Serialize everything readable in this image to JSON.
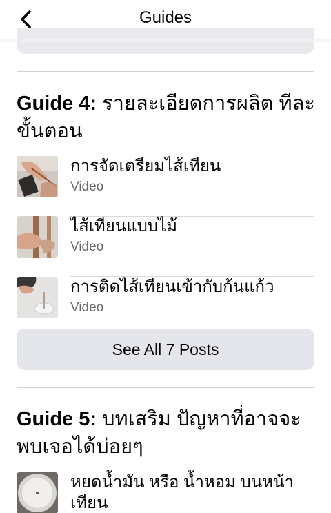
{
  "header": {
    "title": "Guides",
    "back_icon": "chevron-left-icon"
  },
  "guides": [
    {
      "number_label": "Guide 4:",
      "subtitle": "รายละเอียดการผลิต ทีละขั้นตอน",
      "items": [
        {
          "title": "การจัดเตรียมไส้เทียน",
          "type": "Video"
        },
        {
          "title": "ไส้เทียนแบบไม้",
          "type": "Video"
        },
        {
          "title": "การติดไส้เทียนเข้ากับก้นแก้ว",
          "type": "Video"
        }
      ],
      "see_all_label": "See All 7 Posts"
    },
    {
      "number_label": "Guide 5:",
      "subtitle": "บทเสริม ปัญหาที่อาจจะพบเจอได้บ่อยๆ",
      "items": [
        {
          "title": "หยดน้ำมัน หรือ น้ำหอม บนหน้าเทียน"
        }
      ]
    }
  ],
  "colors": {
    "background": "#ffffff",
    "card_gray": "#e4e6eb",
    "secondary_text": "#65676b",
    "divider": "#cfd2d6"
  }
}
